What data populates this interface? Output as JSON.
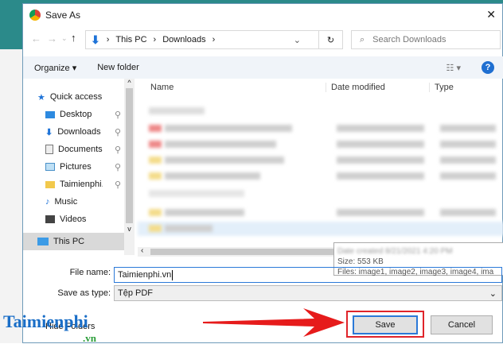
{
  "dialog": {
    "title": "Save As",
    "close": "✕"
  },
  "address": {
    "path": [
      "This PC",
      "Downloads"
    ],
    "search_placeholder": "Search Downloads"
  },
  "toolbar": {
    "organize": "Organize ▾",
    "new_folder": "New folder",
    "help": "?"
  },
  "nav": [
    {
      "label": "Quick access",
      "icon": "star-icon"
    },
    {
      "label": "Desktop",
      "icon": "desktop-icon"
    },
    {
      "label": "Downloads",
      "icon": "download-icon"
    },
    {
      "label": "Documents",
      "icon": "documents-icon"
    },
    {
      "label": "Pictures",
      "icon": "pictures-icon"
    },
    {
      "label": "Taimienphi.vn",
      "icon": "folder-icon"
    },
    {
      "label": "Music",
      "icon": "music-icon"
    },
    {
      "label": "Videos",
      "icon": "videos-icon"
    },
    {
      "label": "This PC",
      "icon": "pc-icon"
    }
  ],
  "columns": {
    "name": "Name",
    "date": "Date modified",
    "type": "Type"
  },
  "tooltip": {
    "size": "Size: 553 KB",
    "files": "Files: image1, image2, image3, image4, ima"
  },
  "form": {
    "file_name_label": "File name:",
    "file_name": "Taimienphi.vn",
    "type_label": "Save as type:",
    "type": "Tệp PDF",
    "hide_folders": "Hide Folders"
  },
  "buttons": {
    "save": "Save",
    "cancel": "Cancel"
  },
  "watermark": "Taimienphi.vn"
}
